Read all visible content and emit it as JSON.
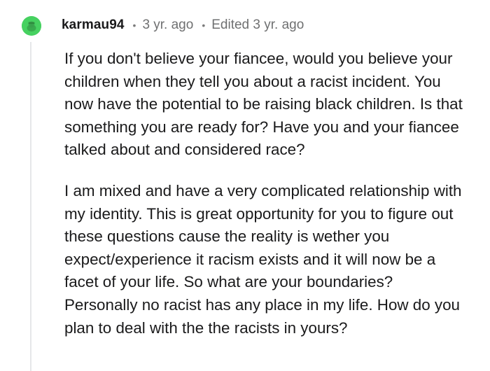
{
  "comment": {
    "username": "karmau94",
    "age": "3 yr. ago",
    "edited": "Edited 3 yr. ago",
    "separator": "•",
    "paragraphs": [
      "If you don't believe your fiancee, would you believe your children when they tell you about a racist incident. You now have the potential to be raising black children. Is that something you are ready for? Have you and your fiancee talked about and considered race?",
      "I am mixed and have a very complicated relationship with my identity. This is great opportunity for you to figure out these questions cause the reality is wether you expect/experience it racism exists and it will now be a facet of your life. So what are your boundaries? Personally no racist has any place in my life. How do you plan to deal with the the racists in yours?"
    ]
  },
  "colors": {
    "avatar_bg": "#46d160",
    "thread_line": "#e5e7e9",
    "muted_text": "#6f7071",
    "body_text": "#1a1a1b"
  },
  "icons": {
    "avatar": "reddit-snoo-avatar-icon"
  }
}
